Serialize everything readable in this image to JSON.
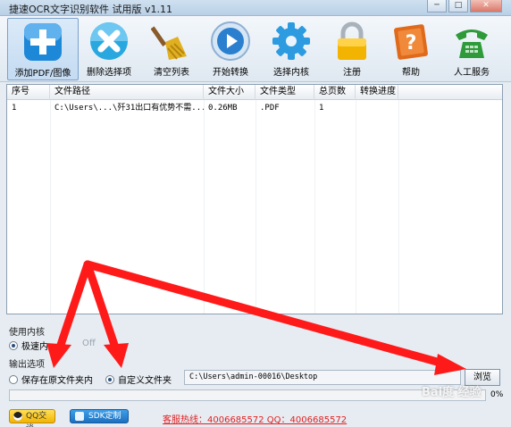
{
  "window": {
    "title": "捷速OCR文字识别软件 试用版 v1.11",
    "buttons": [
      "─",
      "□",
      "✕"
    ]
  },
  "toolbar": [
    {
      "label": "添加PDF/图像",
      "icon": "add-plus-icon",
      "color": "#1e88d8"
    },
    {
      "label": "删除选择项",
      "icon": "delete-x-icon",
      "color": "#29a8e0"
    },
    {
      "label": "清空列表",
      "icon": "broom-icon",
      "color": "#e0b020"
    },
    {
      "label": "开始转换",
      "icon": "play-icon",
      "color": "#2a7fcf"
    },
    {
      "label": "选择内核",
      "icon": "gear-icon",
      "color": "#2c9be0"
    },
    {
      "label": "注册",
      "icon": "lock-icon",
      "color": "#f2b400"
    },
    {
      "label": "帮助",
      "icon": "help-book-icon",
      "color": "#e06a1c"
    },
    {
      "label": "人工服务",
      "icon": "phone-icon",
      "color": "#2e9a3a"
    }
  ],
  "table": {
    "headers": [
      "序号",
      "文件路径",
      "文件大小",
      "文件类型",
      "总页数",
      "转换进度"
    ],
    "rows": [
      [
        "1",
        "C:\\Users\\...\\歼31出口有优势不需...",
        "0.26MB",
        ".PDF",
        "1",
        ""
      ]
    ]
  },
  "engine": {
    "label": "使用内核",
    "option_fast": "极速内",
    "option_off": "Off"
  },
  "output": {
    "label": "输出选项",
    "option_source": "保存在原文件夹内",
    "option_custom": "自定义文件夹",
    "path": "C:\\Users\\admin-00016\\Desktop",
    "browse": "浏览"
  },
  "progress": {
    "percent_text": "0%",
    "value": 0
  },
  "footer": {
    "qq_label": "QQ交谈",
    "sdk_label": "SDK定制",
    "hotline": "客服热线：4006685572 QQ：4006685572"
  },
  "watermark": "Bai度 经验",
  "colors": {
    "arrow": "#ff1a1a",
    "hotline": "#e21f1f",
    "qq": "#f2b400",
    "sdk": "#1d6fbf"
  }
}
